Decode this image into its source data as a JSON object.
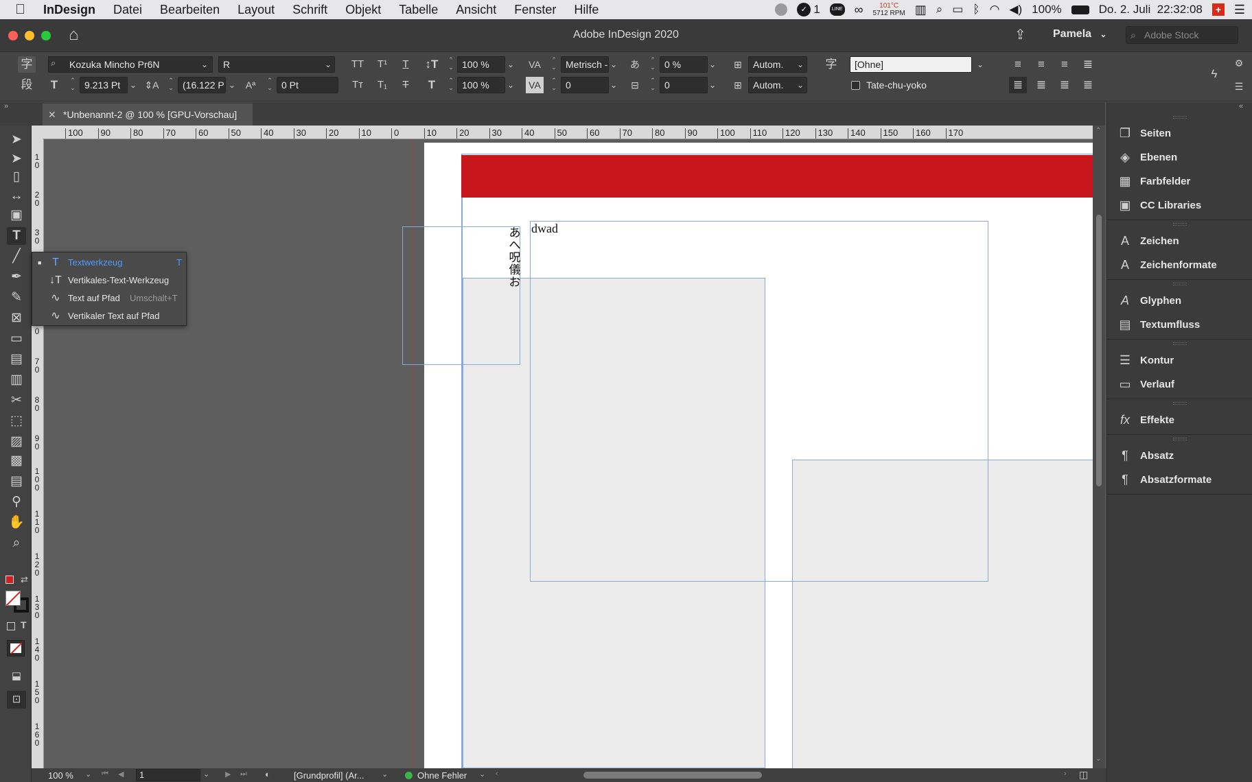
{
  "menubar": {
    "app": "InDesign",
    "items": [
      "Datei",
      "Bearbeiten",
      "Layout",
      "Schrift",
      "Objekt",
      "Tabelle",
      "Ansicht",
      "Fenster",
      "Hilfe"
    ],
    "badge_count": "1",
    "temp": "101°C",
    "rpm": "5712 RPM",
    "battery": "100%",
    "datetime": "Do. 2. Juli  22:32:08"
  },
  "titlebar": {
    "title": "Adobe InDesign 2020",
    "user": "Pamela",
    "search_placeholder": "Adobe Stock"
  },
  "control": {
    "font_family": "Kozuka Mincho Pr6N",
    "font_style": "R",
    "font_size": "9.213 Pt",
    "leading": "(16.122 P",
    "baseline_shift": "0 Pt",
    "vertical_scale": "100 %",
    "horizontal_scale": "100 %",
    "kerning": "Metrisch -",
    "tracking": "0",
    "tsume": "0 %",
    "aki": "0",
    "mojikumi_1": "Autom.",
    "mojikumi_2": "Autom.",
    "char_style": "[Ohne]",
    "tate_chu_yoko": "Tate-chu-yoko"
  },
  "document_tab": {
    "title": "*Unbenannt-2 @ 100 % [GPU-Vorschau]"
  },
  "ruler": {
    "h_labels": [
      "100",
      "90",
      "80",
      "70",
      "60",
      "50",
      "40",
      "30",
      "20",
      "10",
      "0",
      "10",
      "20",
      "30",
      "40",
      "50",
      "60",
      "70",
      "80",
      "90",
      "100",
      "110",
      "120",
      "130",
      "140",
      "150",
      "160",
      "170"
    ],
    "v_labels": [
      "1\n0",
      "2\n0",
      "3\n0",
      "6\n0",
      "7\n0",
      "8\n0",
      "9\n0",
      "1\n0\n0",
      "1\n1\n0",
      "1\n2\n0",
      "1\n3\n0",
      "1\n4\n0",
      "1\n5\n0",
      "1\n6\n0"
    ]
  },
  "canvas": {
    "vertical_text": "あへ呪儀お",
    "frame_text": "dwad",
    "accent_color": "#c8161d"
  },
  "flyout": {
    "items": [
      {
        "label": "Textwerkzeug",
        "shortcut": "T"
      },
      {
        "label": "Vertikales-Text-Werkzeug",
        "shortcut": ""
      },
      {
        "label": "Text auf Pfad",
        "shortcut": "Umschalt+T"
      },
      {
        "label": "Vertikaler Text auf Pfad",
        "shortcut": ""
      }
    ]
  },
  "panels": {
    "items": [
      "Seiten",
      "Ebenen",
      "Farbfelder",
      "CC Libraries",
      "Zeichen",
      "Zeichenformate",
      "Glyphen",
      "Textumfluss",
      "Kontur",
      "Verlauf",
      "Effekte",
      "Absatz",
      "Absatzformate"
    ]
  },
  "statusbar": {
    "zoom": "100 %",
    "page": "1",
    "profile": "[Grundprofil] (Ar...",
    "preflight": "Ohne Fehler"
  }
}
